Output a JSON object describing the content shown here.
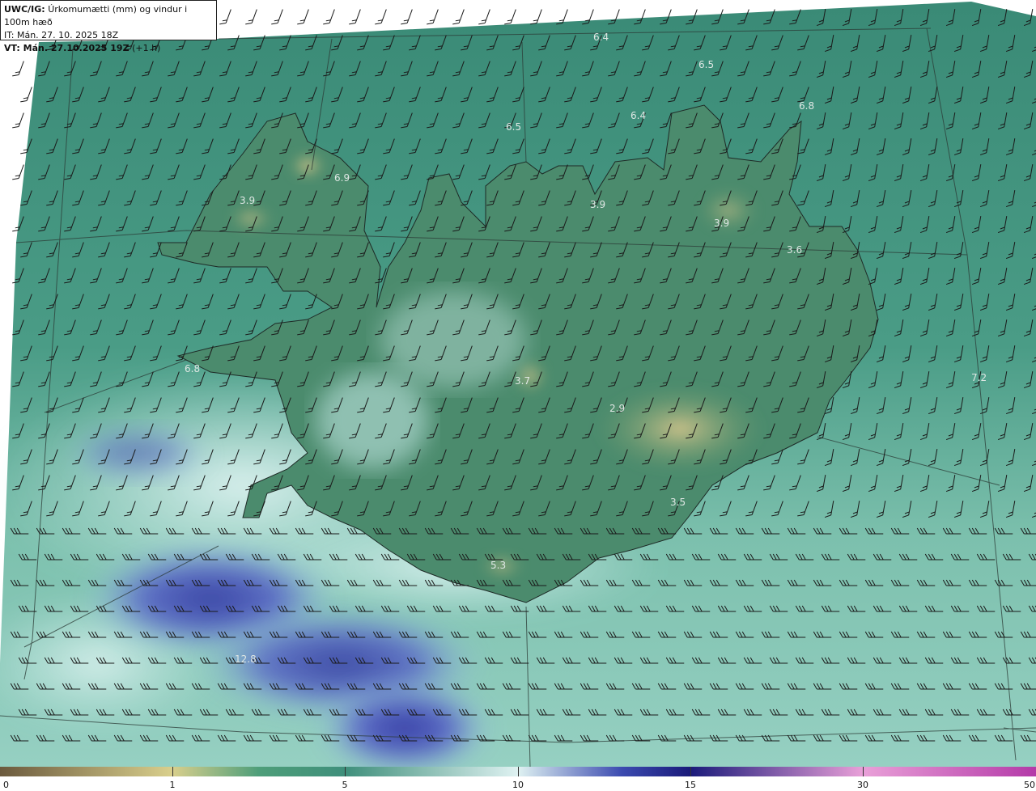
{
  "header": {
    "product": "UWC/IG:",
    "description": "Úrkomumætti (mm) og vindur i 100m hæð",
    "it_line": "IT: Mán. 27. 10. 2025 18Z",
    "vt_label": "VT: Mán. 27.10.2025 19Z",
    "vt_suffix": "(+1 h)"
  },
  "map_labels": [
    {
      "text": "6.4"
    },
    {
      "text": "6.5"
    },
    {
      "text": "6.4"
    },
    {
      "text": "6.5"
    },
    {
      "text": "6.8"
    },
    {
      "text": "6.9"
    },
    {
      "text": "3.9"
    },
    {
      "text": "3.9"
    },
    {
      "text": "3.9"
    },
    {
      "text": "3.6"
    },
    {
      "text": "6.8"
    },
    {
      "text": "3.7"
    },
    {
      "text": "2.9"
    },
    {
      "text": "7.2"
    },
    {
      "text": "3.5"
    },
    {
      "text": "5.3"
    },
    {
      "text": "12.8"
    }
  ],
  "colorbar": {
    "ticks": [
      "0",
      "1",
      "5",
      "10",
      "15",
      "30",
      "50"
    ],
    "colors": {
      "low": "#6b5a3e",
      "yellow": "#d9cf8c",
      "green": "#4e9e7a",
      "teal": "#3f8f7b",
      "light": "#dff2f2",
      "blue": "#3c4bb0",
      "navy": "#1a1a7a",
      "pink": "#e9a0d8",
      "magenta": "#b43aa8"
    }
  },
  "map_colors": {
    "sea": "#3f8f7b",
    "land_green": "#4f8a6a",
    "highland": "#b5b07a",
    "precip_light": "#c8ecea",
    "precip_blue": "#5a64c8",
    "precip_dark": "#2d2f9a"
  }
}
